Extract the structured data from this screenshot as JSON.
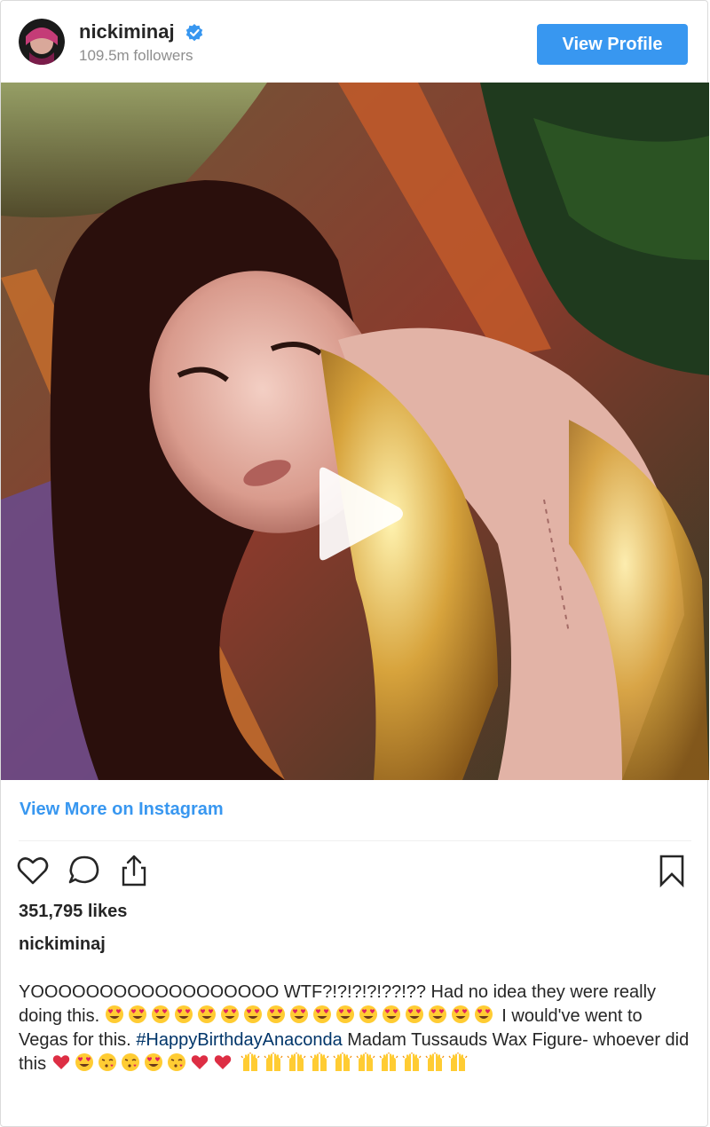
{
  "header": {
    "username": "nickiminaj",
    "followers": "109.5m followers",
    "view_profile_label": "View Profile"
  },
  "media": {
    "type": "video",
    "has_play_button": true
  },
  "footer": {
    "view_more_label": "View More on Instagram",
    "likes": "351,795 likes",
    "caption_user": "nickiminaj",
    "caption_line1_text": "YOOOOOOOOOOOOOOOOOO WTF?!?!?!?!??!?? Had no idea they were really doing this.",
    "caption_mid_text": "I would've went to Vegas for this.",
    "caption_hashtag": "#HappyBirthdayAnaconda",
    "caption_end_text": "Madam Tussauds Wax Figure- whoever did this"
  },
  "icons": {
    "like": "heart-outline-icon",
    "comment": "comment-bubble-icon",
    "share": "share-upload-icon",
    "save": "bookmark-icon",
    "verified": "verified-badge-icon",
    "play": "play-icon",
    "emoji_heart_eyes": "heart-eyes-emoji",
    "emoji_red_heart": "red-heart-emoji",
    "emoji_kiss": "face-blowing-kiss-emoji",
    "emoji_raised_hands": "raised-hands-emoji"
  },
  "colors": {
    "accent": "#3897f0",
    "hashtag": "#003569",
    "border": "#dbdbdb",
    "text": "#262626",
    "muted": "#8e8e8e"
  }
}
